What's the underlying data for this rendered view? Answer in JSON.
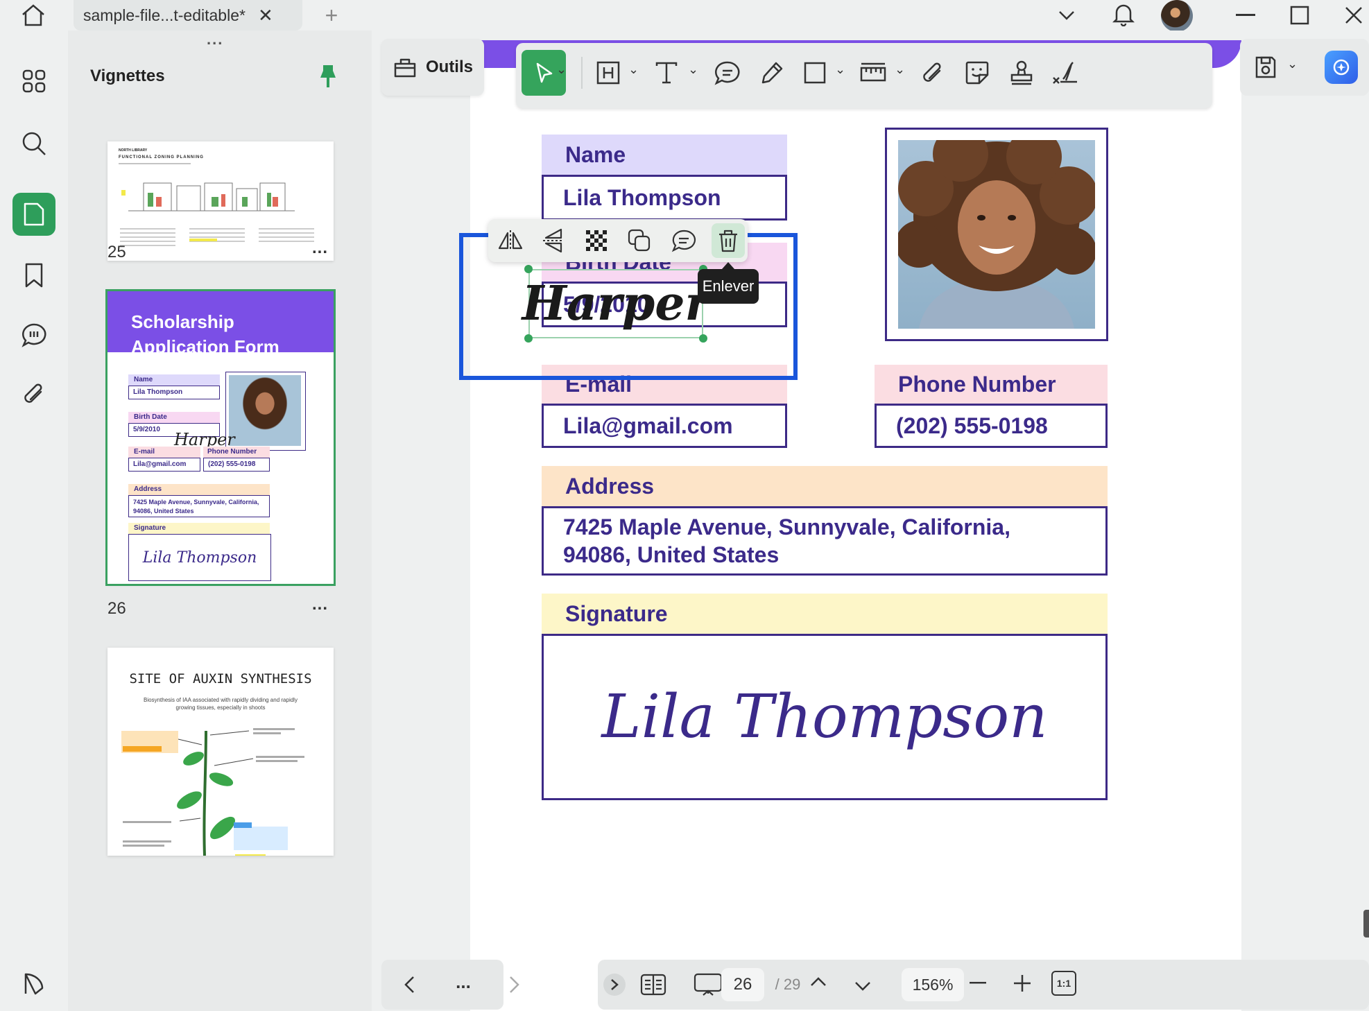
{
  "titlebar": {
    "tab_title": "sample-file...t-editable*",
    "icons": [
      "home-icon",
      "close-icon",
      "plus-icon",
      "chevron-down-icon",
      "bell-icon",
      "avatar",
      "minimize-icon",
      "maximize-icon",
      "close-window-icon"
    ]
  },
  "sidebar": {
    "title": "Vignettes",
    "drag_handle": "...",
    "rail_icons": [
      "grid-icon",
      "search-icon",
      "page-icon",
      "bookmark-icon",
      "comment-icon",
      "attachment-icon",
      "sidebar-bottom-icon"
    ]
  },
  "thumbnails": [
    {
      "page": "25",
      "more": "...",
      "heading1": "NORTH LIBRARY",
      "heading2": "FUNCTIONAL ZONING PLANNING"
    },
    {
      "page": "26",
      "more": "...",
      "title_line1": "Scholarship",
      "title_line2": "Application Form",
      "name_label": "Name",
      "name_value": "Lila Thompson",
      "birth_label": "Birth Date",
      "birth_value": "5/9/2010",
      "sig_overlay": "Harper",
      "email_label": "E-mail",
      "email_value": "Lila@gmail.com",
      "phone_label": "Phone Number",
      "phone_value": "(202) 555-0198",
      "address_label": "Address",
      "address_value": "7425 Maple Avenue, Sunnyvale, California, 94086, United States",
      "signature_label": "Signature",
      "signature_value": "Lila Thompson"
    },
    {
      "page": "27",
      "title": "SITE OF AUXIN SYNTHESIS",
      "subtitle": "Biosynthesis of IAA associated with rapidly dividing and rapidly growing tissues, especially in shoots"
    }
  ],
  "toolbar": {
    "outils_label": "Outils"
  },
  "form": {
    "name_label": "Name",
    "name_value": "Lila Thompson",
    "birth_label": "Birth Date",
    "birth_value": "5/9/2010",
    "email_label": "E-mail",
    "email_value": "Lila@gmail.com",
    "phone_label": "Phone Number",
    "phone_value": "(202) 555-0198",
    "address_label": "Address",
    "address_line1": "7425 Maple Avenue, Sunnyvale, California,",
    "address_line2": "94086, United States",
    "signature_label": "Signature",
    "signature_value": "Lila Thompson"
  },
  "selection": {
    "stamp_text": "Harper",
    "tooltip": "Enlever"
  },
  "bottombar": {
    "more": "...",
    "page_current": "26",
    "page_total": "/ 29",
    "zoom": "156%",
    "ratio": "1:1"
  },
  "colors": {
    "accent_green": "#35a45c",
    "form_purple": "#3b2a8a",
    "header_purple": "#7b4fe6",
    "selection_blue": "#1a56db"
  }
}
